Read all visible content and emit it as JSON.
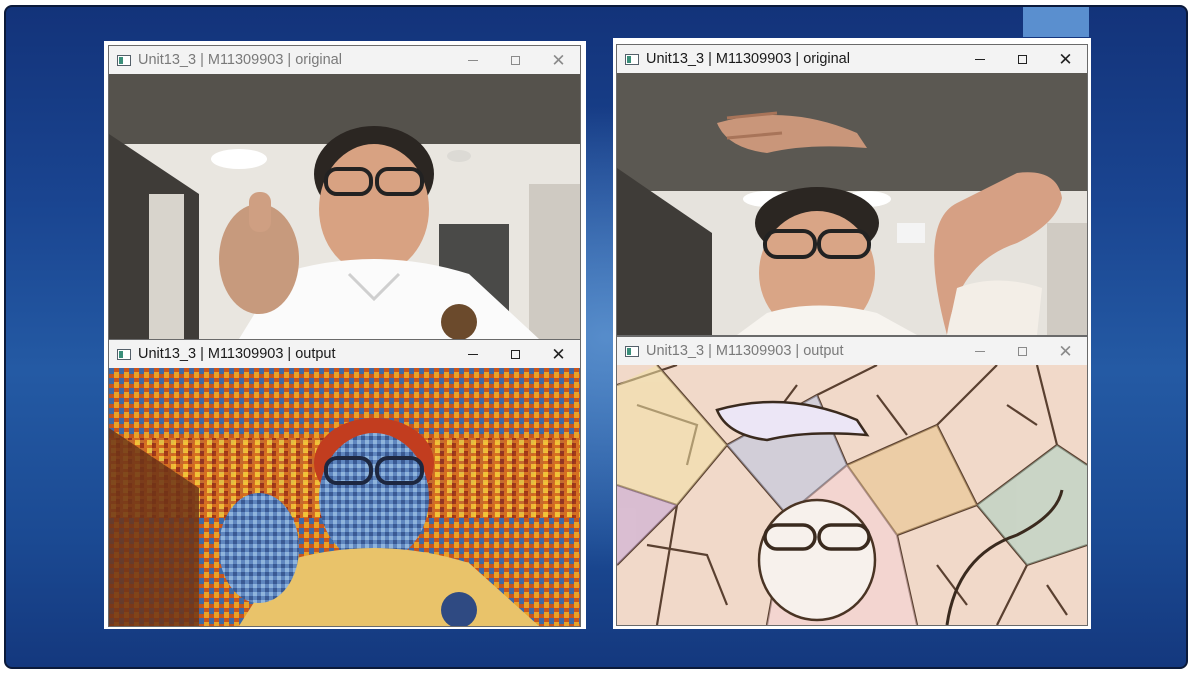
{
  "windows": {
    "left_original": {
      "title": "Unit13_3 | M11309903 | original"
    },
    "left_output": {
      "title": "Unit13_3 | M11309903 | output"
    },
    "right_original": {
      "title": "Unit13_3 | M11309903 | original"
    },
    "right_output": {
      "title": "Unit13_3 | M11309903 | output"
    }
  },
  "controls": {
    "minimize": "—",
    "maximize": "☐",
    "close": "✕"
  },
  "colors": {
    "slide_bg": "#1a4591",
    "accent": "#5a8fcf",
    "titlebar": "#f3f3f3"
  },
  "icons": [
    "opencv-window-icon",
    "minimize-icon",
    "maximize-icon",
    "close-icon"
  ]
}
